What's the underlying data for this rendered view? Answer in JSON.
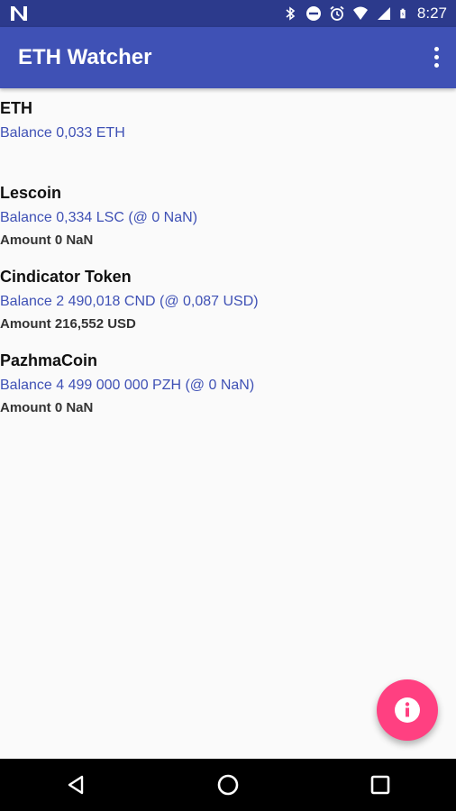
{
  "status_bar": {
    "time": "8:27",
    "icons": [
      "n-logo-icon",
      "bluetooth-icon",
      "do-not-disturb-icon",
      "alarm-icon",
      "wifi-icon",
      "signal-icon",
      "battery-icon"
    ]
  },
  "app_bar": {
    "title": "ETH Watcher",
    "menu_icon": "overflow-menu-icon"
  },
  "tokens": [
    {
      "name": "ETH",
      "balance": "Balance 0,033 ETH",
      "amount": ""
    },
    {
      "name": "Lescoin",
      "balance": "Balance 0,334 LSC (@ 0 NaN)",
      "amount": "Amount 0 NaN"
    },
    {
      "name": "Cindicator Token",
      "balance": "Balance 2 490,018 CND (@ 0,087 USD)",
      "amount": "Amount 216,552 USD"
    },
    {
      "name": "PazhmaCoin",
      "balance": "Balance 4 499 000 000 PZH (@ 0 NaN)",
      "amount": "Amount 0 NaN"
    }
  ],
  "fab": {
    "icon": "info-icon",
    "color": "#ff4081"
  },
  "nav_bar": {
    "icons": [
      "back-icon",
      "home-icon",
      "recents-icon"
    ]
  },
  "colors": {
    "primary": "#3f51b5",
    "primary_dark": "#2c3a8c",
    "accent": "#ff4081"
  }
}
